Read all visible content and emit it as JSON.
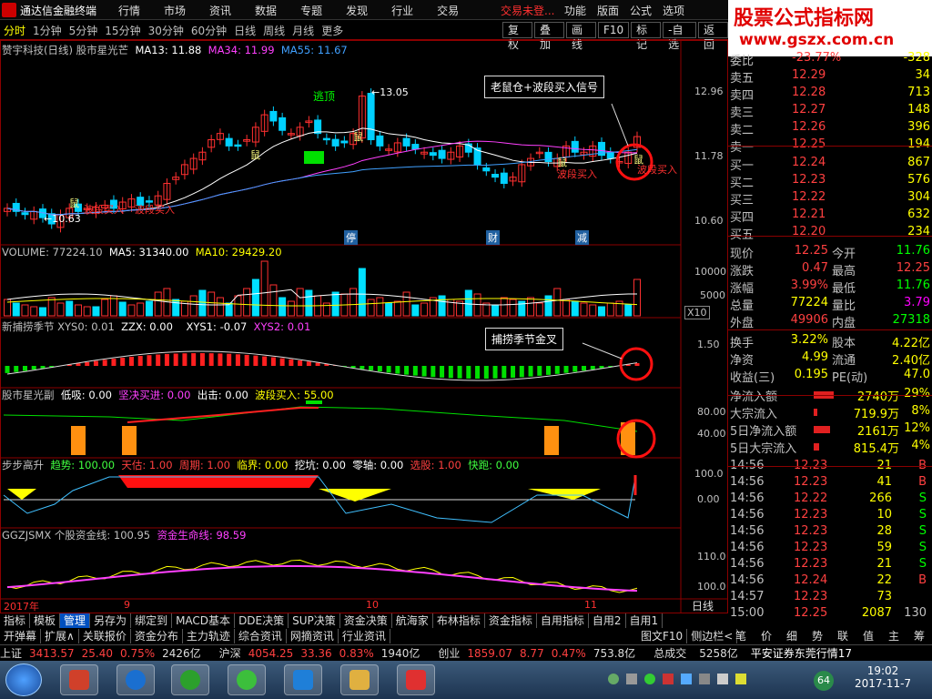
{
  "app": {
    "title": "通达信金融终端",
    "trade_status": "交易未登...",
    "menus": [
      "行情",
      "市场",
      "资讯",
      "数据",
      "专题",
      "发现",
      "行业",
      "交易"
    ],
    "menus_right": [
      "功能",
      "版面",
      "公式",
      "选项"
    ]
  },
  "watermark": {
    "line1": "股票公式指标网",
    "line2": "www.gszx.com.cn"
  },
  "toolbar": {
    "periods": [
      "分时",
      "1分钟",
      "5分钟",
      "15分钟",
      "30分钟",
      "60分钟",
      "日线",
      "周线",
      "月线",
      "更多"
    ],
    "buttons": [
      "复权",
      "叠加",
      "画线",
      "F10",
      "标记",
      "-自选",
      "返回"
    ]
  },
  "main_panel": {
    "title": "赞宇科技(日线) 股市星光芒",
    "ma13": "MA13: 11.88",
    "ma34": "MA34: 11.99",
    "ma55": "MA55: 11.67",
    "escape_label": "逃顶",
    "high_label": "13.05",
    "low_label": "10.63",
    "callout": "老鼠仓+波段买入信号",
    "signal_buy": "波段买入",
    "signal_rat": "鼠",
    "event_markers": [
      "停",
      "财",
      "减"
    ],
    "yticks": [
      "12.96",
      "11.78",
      "10.60"
    ]
  },
  "volume_panel": {
    "title": "VOLUME: 77224.10",
    "ma5": "MA5: 31340.00",
    "ma10": "MA10: 29429.20",
    "yticks": [
      "10000",
      "5000"
    ],
    "unit": "X10"
  },
  "season_panel": {
    "title": "新捕捞季节 XYS0: 0.01",
    "zzx": "ZZX: 0.00",
    "xys1": "XYS1: -0.07",
    "xys2": "XYS2: 0.01",
    "callout": "捕捞季节金叉",
    "ytick": "1.50"
  },
  "star_panel": {
    "title": "股市星光副",
    "low": "低吸: 0.00",
    "firm_buy": "坚决买进: 0.00",
    "out": "出击: 0.00",
    "band_buy": "波段买入: 55.00",
    "yticks": [
      "80.00",
      "40.00"
    ]
  },
  "step_panel": {
    "title": "步步高升",
    "trend": "趋势: 100.00",
    "sky": "天估: 1.00",
    "cycle": "周期: 1.00",
    "critical": "临界: 0.00",
    "dig": "挖坑: 0.00",
    "zero": "零轴: 0.00",
    "pick": "选股: 1.00",
    "run": "快跑: 0.00",
    "yticks": [
      "100.0",
      "0.00"
    ]
  },
  "fund_panel": {
    "title": "GGZJSMX 个股资金线: 100.95",
    "life": "资金生命线: 98.59",
    "yticks": [
      "110.0",
      "100.0"
    ]
  },
  "date_axis": {
    "labels": [
      "2017年",
      "9",
      "10",
      "11"
    ],
    "period": "日线"
  },
  "order_book": {
    "ratio_label": "委比",
    "ratio_value": "-23.77%",
    "diff_label": "委差",
    "diff_value": "-328",
    "asks": [
      {
        "k": "卖五",
        "p": "12.29",
        "v": "34"
      },
      {
        "k": "卖四",
        "p": "12.28",
        "v": "713"
      },
      {
        "k": "卖三",
        "p": "12.27",
        "v": "148"
      },
      {
        "k": "卖二",
        "p": "12.26",
        "v": "396"
      },
      {
        "k": "卖一",
        "p": "12.25",
        "v": "194"
      }
    ],
    "bids": [
      {
        "k": "买一",
        "p": "12.24",
        "v": "867"
      },
      {
        "k": "买二",
        "p": "12.23",
        "v": "576"
      },
      {
        "k": "买三",
        "p": "12.22",
        "v": "304"
      },
      {
        "k": "买四",
        "p": "12.21",
        "v": "632"
      },
      {
        "k": "买五",
        "p": "12.20",
        "v": "234"
      }
    ]
  },
  "stats": [
    {
      "k1": "现价",
      "v1": "12.25",
      "c1": "#ff4040",
      "k2": "今开",
      "v2": "11.76",
      "c2": "#00ff00"
    },
    {
      "k1": "涨跌",
      "v1": "0.47",
      "c1": "#ff4040",
      "k2": "最高",
      "v2": "12.25",
      "c2": "#ff4040"
    },
    {
      "k1": "涨幅",
      "v1": "3.99%",
      "c1": "#ff4040",
      "k2": "最低",
      "v2": "11.76",
      "c2": "#00ff00"
    },
    {
      "k1": "总量",
      "v1": "77224",
      "c1": "#ffff00",
      "k2": "量比",
      "v2": "3.79",
      "c2": "#ff00ff"
    },
    {
      "k1": "外盘",
      "v1": "49906",
      "c1": "#ff4040",
      "k2": "内盘",
      "v2": "27318",
      "c2": "#00ff00"
    },
    {
      "k1": "换手",
      "v1": "3.22%",
      "c1": "#ffff00",
      "k2": "股本",
      "v2": "4.22亿",
      "c2": "#ffff00"
    },
    {
      "k1": "净资",
      "v1": "4.99",
      "c1": "#ffff00",
      "k2": "流通",
      "v2": "2.40亿",
      "c2": "#ffff00"
    },
    {
      "k1": "收益(三)",
      "v1": "0.195",
      "c1": "#ffff00",
      "k2": "PE(动)",
      "v2": "47.0",
      "c2": "#ffff00"
    }
  ],
  "flows": [
    {
      "k": "净流入额",
      "v": "2740万",
      "pct": "29%"
    },
    {
      "k": "大宗流入",
      "v": "719.9万",
      "pct": "8%"
    },
    {
      "k": "5日净流入额",
      "v": "2161万",
      "pct": "12%"
    },
    {
      "k": "5日大宗流入",
      "v": "815.4万",
      "pct": "4%"
    }
  ],
  "ticks": [
    {
      "t": "14:56",
      "p": "12.23",
      "v": "21",
      "s": "B"
    },
    {
      "t": "14:56",
      "p": "12.23",
      "v": "41",
      "s": "B"
    },
    {
      "t": "14:56",
      "p": "12.22",
      "v": "266",
      "s": "S"
    },
    {
      "t": "14:56",
      "p": "12.23",
      "v": "10",
      "s": "S"
    },
    {
      "t": "14:56",
      "p": "12.23",
      "v": "28",
      "s": "S"
    },
    {
      "t": "14:56",
      "p": "12.23",
      "v": "59",
      "s": "S"
    },
    {
      "t": "14:56",
      "p": "12.23",
      "v": "21",
      "s": "S"
    },
    {
      "t": "14:56",
      "p": "12.24",
      "v": "22",
      "s": "B"
    },
    {
      "t": "14:57",
      "p": "12.23",
      "v": "73",
      "s": ""
    },
    {
      "t": "15:00",
      "p": "12.25",
      "v": "2087",
      "s": "130"
    }
  ],
  "bottom_tabs1": [
    "指标",
    "模板",
    "管理",
    "另存为",
    "绑定到",
    "MACD基本",
    "DDE决策",
    "SUP决策",
    "资金决策",
    "航海家",
    "布林指标",
    "资金指标",
    "自用指标",
    "自用2",
    "自用1"
  ],
  "bottom_tabs2": [
    "开弹幕",
    "扩展∧",
    "关联报价",
    "资金分布",
    "主力轨迹",
    "综合资讯",
    "网摘资讯",
    "行业资讯"
  ],
  "bottom_right": [
    "图文F10",
    "侧边栏<"
  ],
  "side_tabs": [
    "笔",
    "价",
    "细",
    "势",
    "联",
    "值",
    "主",
    "筹"
  ],
  "ticker": [
    {
      "name": "上证",
      "price": "3413.57",
      "chg": "25.40",
      "pct": "0.75%",
      "amt": "2426亿"
    },
    {
      "name": "沪深",
      "price": "4054.25",
      "chg": "33.36",
      "pct": "0.83%",
      "amt": "1940亿"
    },
    {
      "name": "创业",
      "price": "1859.07",
      "chg": "8.77",
      "pct": "0.47%",
      "amt": "753.8亿"
    }
  ],
  "ticker_extra": {
    "lbl": "总成交",
    "amt": "5258亿",
    "broker": "平安证券东莞行情17"
  },
  "taskbar": {
    "time": "19:02",
    "date": "2017-11-7",
    "badge": "64"
  },
  "chart_data": [
    {
      "type": "candlestick",
      "name": "赞宇科技(日线)",
      "series": [
        {
          "name": "MA13",
          "value": 11.88
        },
        {
          "name": "MA34",
          "value": 11.99
        },
        {
          "name": "MA55",
          "value": 11.67
        }
      ],
      "ylim": [
        10.6,
        13.05
      ],
      "x": [
        "2017年",
        "9",
        "10",
        "11"
      ]
    },
    {
      "type": "bar",
      "name": "VOLUME",
      "value": 77224.1,
      "series": [
        {
          "name": "MA5",
          "value": 31340.0
        },
        {
          "name": "MA10",
          "value": 29429.2
        }
      ]
    },
    {
      "type": "line",
      "name": "GGZJSMX",
      "series": [
        {
          "name": "个股资金线",
          "value": 100.95
        },
        {
          "name": "资金生命线",
          "value": 98.59
        }
      ]
    }
  ]
}
